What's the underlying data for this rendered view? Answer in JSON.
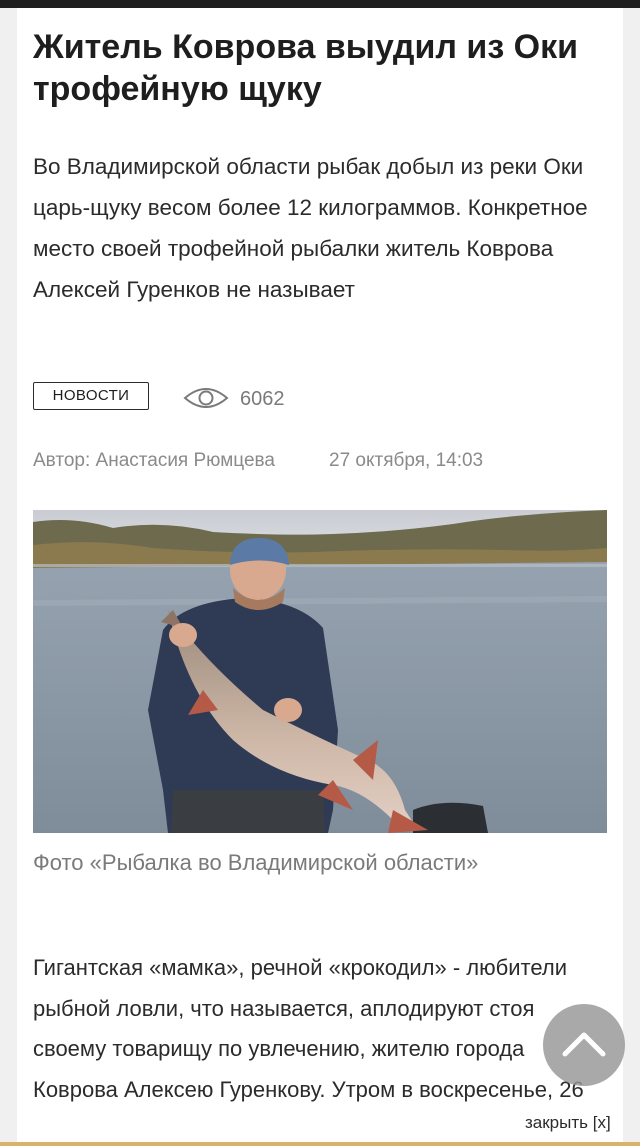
{
  "article": {
    "title": "Житель Коврова выудил из Оки трофейную щуку",
    "lead": "Во Владимирской области рыбак добыл из реки Оки царь-щуку весом более 12 килограммов. Конкретное место своей трофейной рыбалки житель Коврова Алексей Гуренков не называет",
    "tag": "НОВОСТИ",
    "views": "6062",
    "author": "Автор: Анастасия Рюмцева",
    "date": "27 октября, 14:03",
    "photo_caption": "Фото «Рыбалка во Владимирской области»",
    "body": "Гигантская «мамка», речной «крокодил» - любители рыбной ловли, что называется, аплодируют стоя своему товарищу по увлечению, жителю города Коврова Алексею Гуренкову. Утром в воскресенье, 26"
  },
  "overlay": {
    "close_label": "закрыть [x]"
  },
  "icons": {
    "views": "eye-icon",
    "scroll_top": "chevron-up-icon"
  },
  "colors": {
    "text": "#2b2b2b",
    "muted": "#8a8a8a",
    "scroll_button": "#969696"
  }
}
